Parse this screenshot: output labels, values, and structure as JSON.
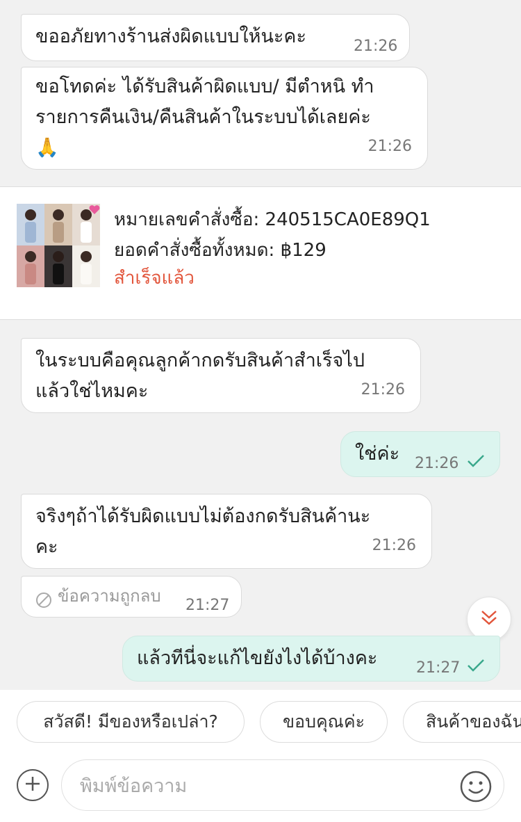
{
  "messages": [
    {
      "text": "ขออภัยทางร้านส่งผิดแบบให้นะคะ",
      "time": "21:26"
    },
    {
      "text": "ขอโทดค่ะ ได้รับสินค้าผิดแบบ/ มีตำหนิ ทำ\nรายการคืนเงิน/คืนสินค้าในระบบได้เลยค่ะ\n🙏",
      "time": "21:26"
    },
    {
      "text": "ในระบบคือคุณลูกค้ากดรับสินค้าสำเร็จไป\nแล้วใช่ไหมคะ",
      "time": "21:26"
    },
    {
      "text": "ใช่ค่ะ",
      "time": "21:26"
    },
    {
      "text": "จริงๆถ้าได้รับผิดแบบไม่ต้องกดรับสินค้านะ\nคะ",
      "time": "21:26"
    },
    {
      "text": "ข้อความถูกลบ",
      "time": "21:27"
    },
    {
      "text": "แล้วทีนี่จะแก้ไขยังไงได้บ้างคะ",
      "time": "21:27"
    }
  ],
  "order": {
    "number_line": "หมายเลขคำสั่งซื้อ: 240515CA0E89Q1",
    "total_line": "ยอดคำสั่งซื้อทั้งหมด: ฿129",
    "status": "สำเร็จแล้ว"
  },
  "quick_replies": [
    "สวัสดี! มีของหรือเปล่า?",
    "ขอบคุณค่ะ",
    "สินค้าของฉัน"
  ],
  "composer": {
    "placeholder": "พิมพ์ข้อความ"
  },
  "colors": {
    "accent": "#e2553b",
    "outgoing_bubble": "#dcf5ef",
    "read_tick": "#3aa88c"
  },
  "icons": [
    "check-icon",
    "deleted-icon",
    "double-chevron-down-icon",
    "plus-icon",
    "emoji-icon",
    "heart-icon"
  ]
}
